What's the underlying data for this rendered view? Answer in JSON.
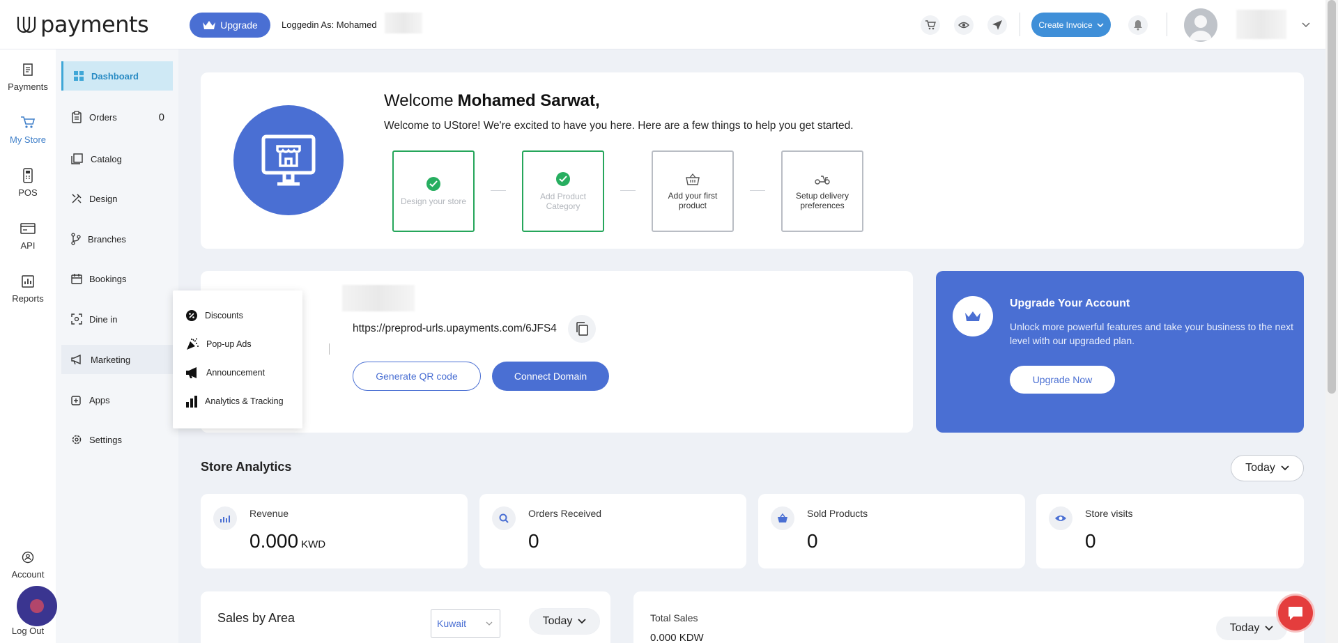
{
  "header": {
    "logo_text": "payments",
    "upgrade_label": "Upgrade",
    "logged_in_label": "Loggedin As: Mohamed",
    "create_invoice_label": "Create Invoice"
  },
  "rail": {
    "items": [
      {
        "label": "Payments",
        "icon": "receipt-icon"
      },
      {
        "label": "My Store",
        "icon": "cart-icon"
      },
      {
        "label": "POS",
        "icon": "pos-icon"
      },
      {
        "label": "API",
        "icon": "api-icon"
      },
      {
        "label": "Reports",
        "icon": "reports-icon"
      }
    ],
    "account_label": "Account",
    "logout_label": "Log Out"
  },
  "submenu": {
    "items": [
      {
        "label": "Dashboard",
        "icon": "grid-icon"
      },
      {
        "label": "Orders",
        "icon": "clipboard-icon",
        "count": "0"
      },
      {
        "label": "Catalog",
        "icon": "catalog-icon"
      },
      {
        "label": "Design",
        "icon": "design-icon"
      },
      {
        "label": "Branches",
        "icon": "branch-icon"
      },
      {
        "label": "Bookings",
        "icon": "calendar-icon"
      },
      {
        "label": "Dine in",
        "icon": "dine-icon"
      },
      {
        "label": "Marketing",
        "icon": "megaphone-icon"
      },
      {
        "label": "Apps",
        "icon": "apps-icon"
      },
      {
        "label": "Settings",
        "icon": "gear-icon"
      }
    ]
  },
  "marketing_popover": {
    "items": [
      {
        "label": "Discounts",
        "icon": "discount-icon"
      },
      {
        "label": "Pop-up Ads",
        "icon": "party-icon"
      },
      {
        "label": "Announcement",
        "icon": "megaphone-icon"
      },
      {
        "label": "Analytics & Tracking",
        "icon": "bar-chart-icon"
      }
    ]
  },
  "welcome": {
    "greeting": "Welcome",
    "name": "Mohamed Sarwat,",
    "subtitle": "Welcome to UStore! We're excited to have you here. Here are a few things to help you get started.",
    "steps": [
      {
        "label": "Design your store",
        "done": true
      },
      {
        "label": "Add Product Category",
        "done": true
      },
      {
        "label": "Add your first product",
        "done": false
      },
      {
        "label": "Setup delivery preferences",
        "done": false
      }
    ]
  },
  "store_link": {
    "url": "https://preprod-urls.upayments.com/6JFS4",
    "qr_label": "Generate QR code",
    "domain_label": "Connect Domain"
  },
  "upgrade_card": {
    "title": "Upgrade Your Account",
    "text": "Unlock more powerful features and take your business to the next level with our upgraded plan.",
    "button": "Upgrade Now"
  },
  "analytics": {
    "title": "Store Analytics",
    "period": "Today",
    "stats": [
      {
        "label": "Revenue",
        "value": "0.000",
        "unit": "KWD",
        "icon": "chart-icon"
      },
      {
        "label": "Orders Received",
        "value": "0",
        "icon": "search-icon"
      },
      {
        "label": "Sold Products",
        "value": "0",
        "icon": "basket-icon"
      },
      {
        "label": "Store visits",
        "value": "0",
        "icon": "eye-icon"
      }
    ]
  },
  "sales_by_area": {
    "title": "Sales by Area",
    "country": "Kuwait",
    "period": "Today"
  },
  "total_sales": {
    "label": "Total Sales",
    "value": "0.000 KDW",
    "period": "Today"
  },
  "colors": {
    "primary": "#4a6fd3",
    "accent": "#3f8fd8",
    "success": "#27ae60"
  }
}
